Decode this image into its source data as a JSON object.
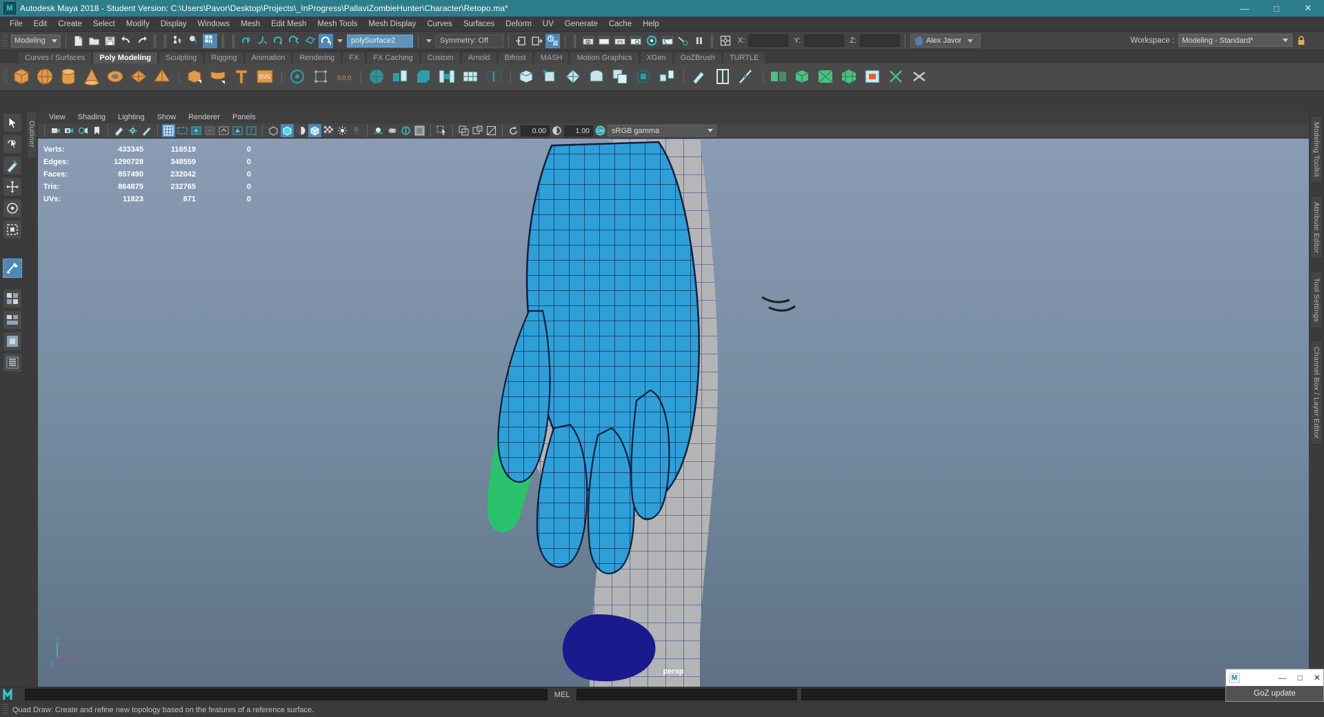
{
  "window": {
    "title": "Autodesk Maya 2018 - Student Version: C:\\Users\\Pavor\\Desktop\\Projects\\_InProgress\\PallaviZombieHunter\\Character\\Retopo.ma*",
    "app_badge": "M",
    "minimize": "—",
    "maximize": "□",
    "close": "✕",
    "accent_color": "#2d7d8c"
  },
  "menubar": {
    "items": [
      {
        "label": "File"
      },
      {
        "label": "Edit"
      },
      {
        "label": "Create"
      },
      {
        "label": "Select"
      },
      {
        "label": "Modify"
      },
      {
        "label": "Display"
      },
      {
        "label": "Windows"
      },
      {
        "label": "Mesh"
      },
      {
        "label": "Edit Mesh"
      },
      {
        "label": "Mesh Tools"
      },
      {
        "label": "Mesh Display"
      },
      {
        "label": "Curves"
      },
      {
        "label": "Surfaces"
      },
      {
        "label": "Deform"
      },
      {
        "label": "UV"
      },
      {
        "label": "Generate"
      },
      {
        "label": "Cache"
      },
      {
        "label": "Help"
      }
    ]
  },
  "statusline": {
    "mode": "Modeling",
    "selection_name": "polySurface2",
    "symmetry": "Symmetry: Off",
    "coord_x_label": "X:",
    "coord_y_label": "Y:",
    "coord_z_label": "Z:",
    "coord_x_value": "",
    "coord_y_value": "",
    "coord_z_value": "",
    "user_name": "Alex Javor"
  },
  "workspace": {
    "label": "Workspace :",
    "value": "Modeling - Standard*"
  },
  "shelf": {
    "tabs": [
      {
        "label": "Curves / Surfaces",
        "active": false
      },
      {
        "label": "Poly Modeling",
        "active": true
      },
      {
        "label": "Sculpting",
        "active": false
      },
      {
        "label": "Rigging",
        "active": false
      },
      {
        "label": "Animation",
        "active": false
      },
      {
        "label": "Rendering",
        "active": false
      },
      {
        "label": "FX",
        "active": false
      },
      {
        "label": "FX Caching",
        "active": false
      },
      {
        "label": "Custom",
        "active": false
      },
      {
        "label": "Arnold",
        "active": false
      },
      {
        "label": "Bifrost",
        "active": false
      },
      {
        "label": "MASH",
        "active": false
      },
      {
        "label": "Motion Graphics",
        "active": false
      },
      {
        "label": "XGen",
        "active": false
      },
      {
        "label": "GoZBrush",
        "active": false
      },
      {
        "label": "TURTLE",
        "active": false
      }
    ]
  },
  "viewport": {
    "menu": [
      {
        "label": "View"
      },
      {
        "label": "Shading"
      },
      {
        "label": "Lighting"
      },
      {
        "label": "Show"
      },
      {
        "label": "Renderer"
      },
      {
        "label": "Panels"
      }
    ],
    "exposure_value": "0.00",
    "gamma_value": "1.00",
    "color_profile": "sRGB gamma",
    "camera_label": "persp",
    "background_top": "#8094ae",
    "background_bottom": "#6a7f9c",
    "axis_labels": {
      "y": "Y",
      "x": "X",
      "z": "Z"
    }
  },
  "hud": {
    "columns": [
      "",
      "",
      "",
      ""
    ],
    "rows": [
      {
        "label": "Verts:",
        "total": "433345",
        "selected": "116519",
        "third": "0"
      },
      {
        "label": "Edges:",
        "total": "1290728",
        "selected": "348559",
        "third": "0"
      },
      {
        "label": "Faces:",
        "total": "857490",
        "selected": "232042",
        "third": "0"
      },
      {
        "label": "Tris:",
        "total": "864875",
        "selected": "232765",
        "third": "0"
      },
      {
        "label": "UVs:",
        "total": "11823",
        "selected": "871",
        "third": "0"
      }
    ]
  },
  "rails": {
    "outliner_label": "Outliner",
    "right_items": [
      "Modeling Toolkit",
      "Attribute Editor",
      "Tool Settings",
      "Channel Box / Layer Editor"
    ]
  },
  "bottom": {
    "mel_label": "MEL",
    "command_value": "",
    "mel_value": "",
    "help_text": "Quad Draw: Create and refine new topology based on the features of a reference surface."
  },
  "goz": {
    "icon_label": "M",
    "minimize": "—",
    "maximize": "□",
    "close": "✕",
    "button_label": "GoZ update"
  }
}
